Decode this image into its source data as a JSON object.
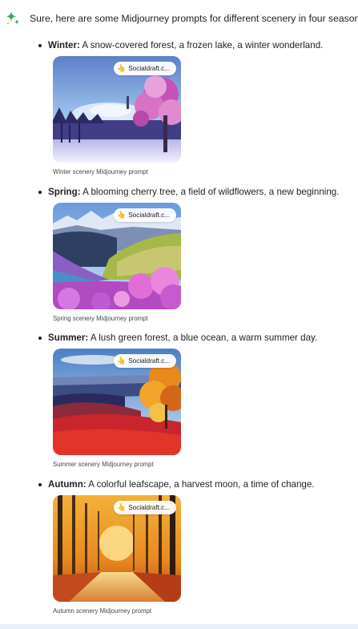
{
  "intro": "Sure, here are some Midjourney prompts for different scenery in four seasons:",
  "source_chip": "Socialdraft.c...",
  "items": [
    {
      "label": "Winter:",
      "text": "A snow-covered forest, a frozen lake, a winter wonderland.",
      "caption": "Winter scenery Midjourney prompt"
    },
    {
      "label": "Spring:",
      "text": "A blooming cherry tree, a field of wildflowers, a new beginning.",
      "caption": "Spring scenery Midjourney prompt"
    },
    {
      "label": "Summer:",
      "text": "A lush green forest, a blue ocean, a warm summer day.",
      "caption": "Summer scenery Midjourney prompt"
    },
    {
      "label": "Autumn:",
      "text": "A colorful leafscape, a harvest moon, a time of change.",
      "caption": "Autumn scenery Midjourney prompt"
    }
  ],
  "colors": {
    "sparkle_blue": "#4285f4",
    "sparkle_green": "#34a853",
    "sparkle_yellow": "#fbbc04"
  }
}
